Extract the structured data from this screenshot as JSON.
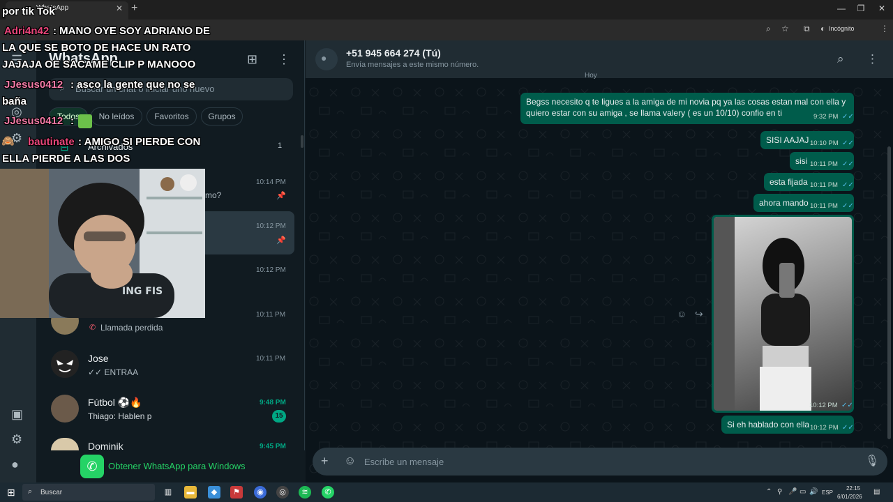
{
  "browser": {
    "tab_title": "WhatsApp",
    "tab_close": "✕",
    "new_tab": "+",
    "incognito_label": "Incógnito",
    "win_min": "—",
    "win_max": "❐",
    "win_close": "✕"
  },
  "sidebar": {
    "title": "WhatsApp",
    "search_placeholder": "Buscar un chat o iniciar uno nuevo",
    "filters": [
      "Todos",
      "No leídos",
      "Favoritos",
      "Grupos"
    ],
    "archived_label": "Archivados",
    "archived_count": "1",
    "chats": [
      {
        "name": "",
        "preview": "mo?",
        "time": "10:14 PM",
        "pinned": true
      },
      {
        "name": "",
        "preview": "",
        "time": "10:12 PM",
        "pinned": true,
        "active": true
      },
      {
        "name": "",
        "preview": "",
        "time": "10:12 PM"
      },
      {
        "name": "",
        "preview": "Llamada perdida",
        "time": "10:11 PM"
      },
      {
        "name": "Jose",
        "preview": "✓✓ ENTRAA",
        "time": "10:11 PM"
      },
      {
        "name": "Fútbol ⚽🔥",
        "preview": "Thiago: Hablen p",
        "time": "9:48 PM",
        "unread": "15"
      },
      {
        "name": "Dominik",
        "preview": "",
        "time": "9:45 PM"
      }
    ],
    "get_app_label": "Obtener WhatsApp para Windows"
  },
  "chat": {
    "contact_name": "+51 945 664 274 (Tú)",
    "contact_sub": "Envía mensajes a este mismo número.",
    "date_chip": "Hoy",
    "messages": [
      {
        "text": "Begss necesito q te ligues a la amiga de mi novia pq ya las cosas estan mal con ella y quiero estar con su amiga , se llama valery ( es un 10/10) confio en ti",
        "time": "9:32 PM"
      },
      {
        "text": "SISI AAJAJ",
        "time": "10:10 PM"
      },
      {
        "text": "sisi",
        "time": "10:11 PM"
      },
      {
        "text": "esta fijada",
        "time": "10:11 PM"
      },
      {
        "text": "ahora mando",
        "time": "10:11 PM"
      },
      {
        "text": "",
        "time": "10:12 PM",
        "type": "image"
      },
      {
        "text": "Si eh hablado con ella",
        "time": "10:12 PM"
      }
    ],
    "composer_placeholder": "Escribe un mensaje"
  },
  "taskbar": {
    "search_label": "Buscar",
    "lang": "ESP",
    "time": "22:15",
    "date": "6/01/2026"
  },
  "overlay": {
    "header": "por tik Tok",
    "comments": [
      {
        "user": "Adri4n42",
        "text": ": MANO OYE SOY ADRIANO DE"
      },
      {
        "user": "",
        "text": "LA QUE SE BOTO DE HACE UN RATO"
      },
      {
        "user": "",
        "text": "JAJAJA OE SACAME CLIP P MANOOO"
      },
      {
        "user": "JJesus0412",
        "text": ": asco la gente que no se"
      },
      {
        "user": "",
        "text": "baña"
      },
      {
        "user": "JJesus0412",
        "text": ":"
      },
      {
        "user": "bautinate",
        "text": ": AMIGO SI PIERDE CON"
      },
      {
        "user": "",
        "text": "ELLA PIERDE A LAS DOS"
      }
    ]
  },
  "colors": {
    "accent": "#00a884",
    "outgoing_bubble": "#005c4b",
    "panel": "#202c33",
    "background": "#111b21",
    "read_ticks": "#53bdeb"
  }
}
